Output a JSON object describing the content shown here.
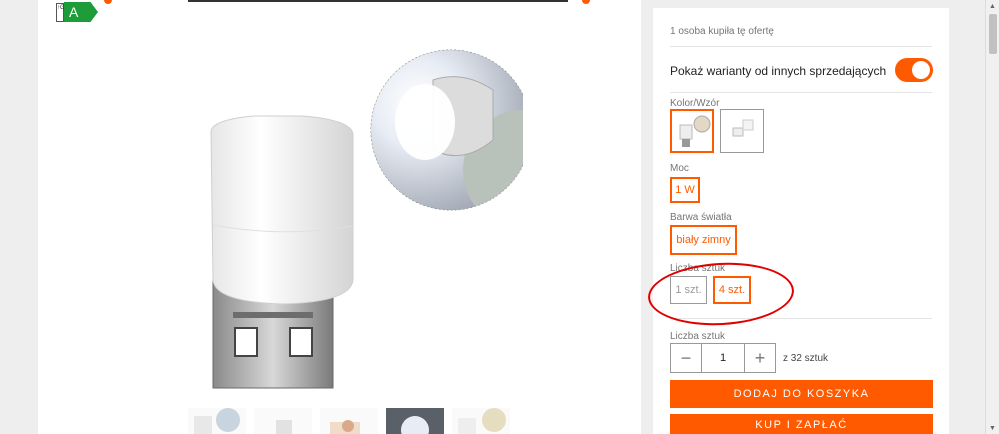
{
  "energy_label": {
    "scale_text": "↑G",
    "class_letter": "A"
  },
  "colors": {
    "accent": "#ff5a00",
    "highlight": "#e00000",
    "energy_green": "#1f9c3a"
  },
  "panel": {
    "bought_text": "1 osoba kupiła tę ofertę",
    "show_variants_label": "Pokaż warianty od innych sprzedających",
    "show_variants_on": true,
    "color_label": "Kolor/Wzór",
    "power_label": "Moc",
    "power_options": [
      "1 W"
    ],
    "light_label": "Barwa światła",
    "light_options": [
      "biały zimny"
    ],
    "pieces_label": "Liczba sztuk",
    "pieces_options": [
      "1 szt.",
      "4 szt."
    ],
    "quantity_label": "Liczba sztuk",
    "quantity_value": "1",
    "quantity_of": "z 32 sztuk",
    "add_to_cart": "DODAJ DO KOSZYKA",
    "buy_now": "KUP I ZAPŁAĆ"
  },
  "icons": {
    "minus": "minus-icon",
    "plus": "plus-icon",
    "scroll_up": "chevron-up-icon",
    "scroll_down": "chevron-down-icon"
  }
}
